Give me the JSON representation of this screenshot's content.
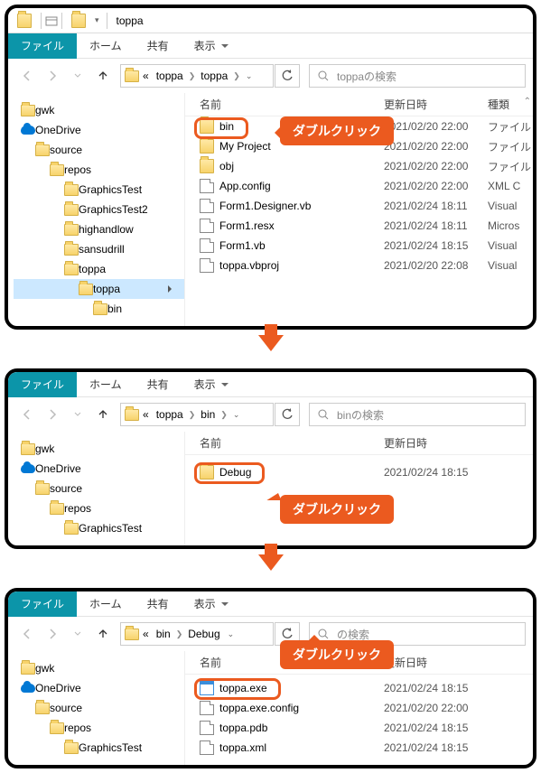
{
  "callout_text": "ダブルクリック",
  "tabs": {
    "file": "ファイル",
    "home": "ホーム",
    "share": "共有",
    "view": "表示"
  },
  "headers": {
    "name": "名前",
    "date": "更新日時",
    "type": "種類"
  },
  "panel1": {
    "title": "toppa",
    "crumbs": [
      "«",
      "toppa",
      "toppa"
    ],
    "search_placeholder": "toppaの検索",
    "tree": [
      {
        "indent": 0,
        "icon": "folder",
        "label": "gwk"
      },
      {
        "indent": 0,
        "icon": "onedrive",
        "label": "OneDrive"
      },
      {
        "indent": 1,
        "icon": "folder",
        "label": "source"
      },
      {
        "indent": 2,
        "icon": "folder",
        "label": "repos"
      },
      {
        "indent": 3,
        "icon": "folder",
        "label": "GraphicsTest"
      },
      {
        "indent": 3,
        "icon": "folder",
        "label": "GraphicsTest2"
      },
      {
        "indent": 3,
        "icon": "folder",
        "label": "highandlow"
      },
      {
        "indent": 3,
        "icon": "folder",
        "label": "sansudrill"
      },
      {
        "indent": 3,
        "icon": "folder",
        "label": "toppa"
      },
      {
        "indent": 4,
        "icon": "folder",
        "label": "toppa",
        "selected": true
      },
      {
        "indent": 5,
        "icon": "folder",
        "label": "bin"
      }
    ],
    "files": [
      {
        "icon": "folder",
        "name": "bin",
        "date": "2021/02/20 22:00",
        "type": "ファイル",
        "highlight": true
      },
      {
        "icon": "folder",
        "name": "My Project",
        "date": "2021/02/20 22:00",
        "type": "ファイル"
      },
      {
        "icon": "folder",
        "name": "obj",
        "date": "2021/02/20 22:00",
        "type": "ファイル"
      },
      {
        "icon": "file",
        "name": "App.config",
        "date": "2021/02/20 22:00",
        "type": "XML C"
      },
      {
        "icon": "file",
        "name": "Form1.Designer.vb",
        "date": "2021/02/24 18:11",
        "type": "Visual"
      },
      {
        "icon": "file",
        "name": "Form1.resx",
        "date": "2021/02/24 18:11",
        "type": "Micros"
      },
      {
        "icon": "file",
        "name": "Form1.vb",
        "date": "2021/02/24 18:15",
        "type": "Visual"
      },
      {
        "icon": "file",
        "name": "toppa.vbproj",
        "date": "2021/02/20 22:08",
        "type": "Visual"
      }
    ]
  },
  "panel2": {
    "crumbs": [
      "«",
      "toppa",
      "bin"
    ],
    "search_placeholder": "binの検索",
    "tree": [
      {
        "indent": 0,
        "icon": "folder",
        "label": "gwk"
      },
      {
        "indent": 0,
        "icon": "onedrive",
        "label": "OneDrive"
      },
      {
        "indent": 1,
        "icon": "folder",
        "label": "source"
      },
      {
        "indent": 2,
        "icon": "folder",
        "label": "repos"
      },
      {
        "indent": 3,
        "icon": "folder",
        "label": "GraphicsTest"
      }
    ],
    "files": [
      {
        "icon": "folder",
        "name": "Debug",
        "date": "2021/02/24 18:15",
        "highlight": true
      }
    ]
  },
  "panel3": {
    "crumbs": [
      "«",
      "bin",
      "Debug"
    ],
    "search_placeholder": "の検索",
    "tree": [
      {
        "indent": 0,
        "icon": "folder",
        "label": "gwk"
      },
      {
        "indent": 0,
        "icon": "onedrive",
        "label": "OneDrive"
      },
      {
        "indent": 1,
        "icon": "folder",
        "label": "source"
      },
      {
        "indent": 2,
        "icon": "folder",
        "label": "repos"
      },
      {
        "indent": 3,
        "icon": "folder",
        "label": "GraphicsTest"
      }
    ],
    "files": [
      {
        "icon": "exe",
        "name": "toppa.exe",
        "date": "2021/02/24 18:15",
        "highlight": true
      },
      {
        "icon": "file",
        "name": "toppa.exe.config",
        "date": "2021/02/20 22:00"
      },
      {
        "icon": "file",
        "name": "toppa.pdb",
        "date": "2021/02/24 18:15"
      },
      {
        "icon": "file",
        "name": "toppa.xml",
        "date": "2021/02/24 18:15"
      }
    ]
  }
}
